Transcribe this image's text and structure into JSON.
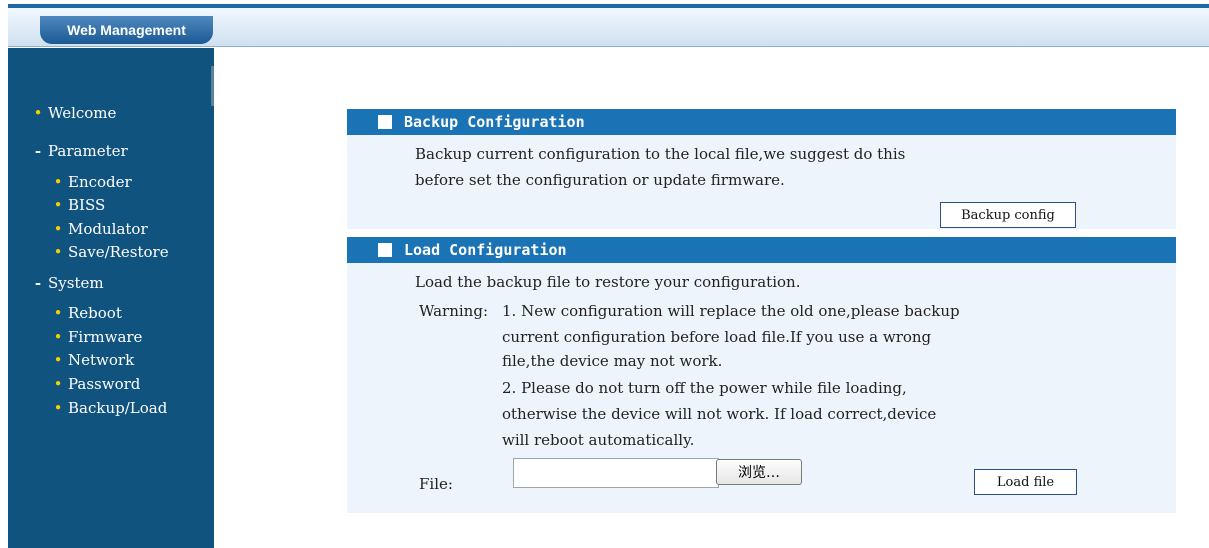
{
  "header": {
    "tab_label": "Web Management"
  },
  "sidebar": {
    "items": [
      {
        "label": "Welcome",
        "marker": "bullet"
      },
      {
        "label": "Parameter",
        "marker": "minus"
      },
      {
        "label": "Encoder",
        "marker": "bullet"
      },
      {
        "label": "BISS",
        "marker": "bullet"
      },
      {
        "label": "Modulator",
        "marker": "bullet"
      },
      {
        "label": "Save/Restore",
        "marker": "bullet"
      },
      {
        "label": "System",
        "marker": "minus"
      },
      {
        "label": "Reboot",
        "marker": "bullet"
      },
      {
        "label": "Firmware",
        "marker": "bullet"
      },
      {
        "label": "Network",
        "marker": "bullet"
      },
      {
        "label": "Password",
        "marker": "bullet"
      },
      {
        "label": "Backup/Load",
        "marker": "bullet"
      }
    ]
  },
  "backup": {
    "title": "Backup Configuration",
    "desc_line1": "Backup current configuration to the local file,we suggest do this",
    "desc_line2": "before set the configuration or update firmware.",
    "button": "Backup config"
  },
  "load": {
    "title": "Load Configuration",
    "intro": "Load the backup file to restore your configuration.",
    "warning_label": "Warning:",
    "w1_line1": "1. New configuration will replace the old one,please backup",
    "w1_line2": "current configuration before load file.If you use a wrong",
    "w1_line3": "file,the device may not work.",
    "w2_line1": "2. Please do not turn off the power while file loading,",
    "w2_line2": "otherwise the device will not work. If load correct,device",
    "w2_line3": "will reboot automatically.",
    "file_label": "File:",
    "file_value": "",
    "browse_button": "浏览…",
    "load_button": "Load file"
  },
  "colors": {
    "sidebar_bg": "#11537f",
    "section_header": "#1a73b5",
    "bullet": "#f1d100",
    "panel_bg": "#eef4fb"
  }
}
